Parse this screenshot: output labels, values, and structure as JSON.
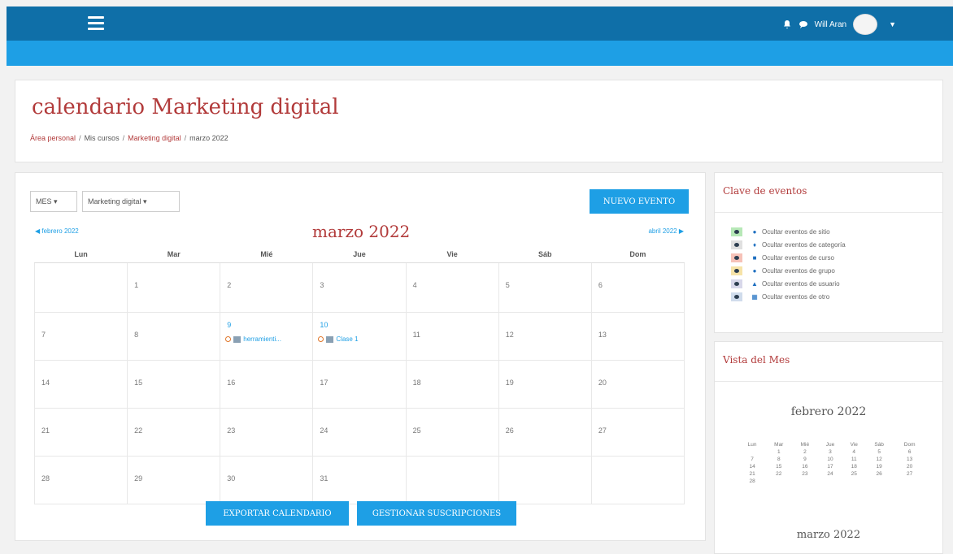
{
  "navbar": {
    "user_name": "Will Aran"
  },
  "header": {
    "title": "calendario Marketing digital",
    "breadcrumb": [
      "Área personal",
      "Mis cursos",
      "Marketing digital",
      "marzo 2022"
    ]
  },
  "calendar": {
    "view_select": "MES",
    "course_select": "Marketing digital",
    "new_event_label": "NUEVO EVENTO",
    "prev_month": "febrero 2022",
    "next_month": "abril 2022",
    "month_title": "marzo 2022",
    "weekdays": [
      "Lun",
      "Mar",
      "Mié",
      "Jue",
      "Vie",
      "Sáb",
      "Dom"
    ],
    "weeks": [
      [
        "",
        "1",
        "2",
        "3",
        "4",
        "5",
        "6"
      ],
      [
        "7",
        "8",
        "9",
        "10",
        "11",
        "12",
        "13"
      ],
      [
        "14",
        "15",
        "16",
        "17",
        "18",
        "19",
        "20"
      ],
      [
        "21",
        "22",
        "23",
        "24",
        "25",
        "26",
        "27"
      ],
      [
        "28",
        "29",
        "30",
        "31",
        "",
        "",
        ""
      ]
    ],
    "events": {
      "day9": "herramienti...",
      "day10": "Clase 1"
    },
    "export_label": "EXPORTAR CALENDARIO",
    "subscriptions_label": "GESTIONAR SUSCRIPCIONES"
  },
  "legend": {
    "title": "Clave de eventos",
    "items": [
      {
        "label": "Ocultar eventos de sitio",
        "color": "#b7e8b7",
        "icon": "globe-icon"
      },
      {
        "label": "Ocultar eventos de categoría",
        "color": "#e0e0e0",
        "icon": "cubes-icon"
      },
      {
        "label": "Ocultar eventos de curso",
        "color": "#f6c2b8",
        "icon": "graduation-icon"
      },
      {
        "label": "Ocultar eventos de grupo",
        "color": "#f6e3a8",
        "icon": "users-icon"
      },
      {
        "label": "Ocultar eventos de usuario",
        "color": "#d8d8ea",
        "icon": "user-icon"
      },
      {
        "label": "Ocultar eventos de otro",
        "color": "#d0dcec",
        "icon": "calendar-icon"
      }
    ]
  },
  "month_view": {
    "title": "Vista del Mes",
    "current_month": "febrero 2022",
    "weekdays": [
      "Lun",
      "Mar",
      "Mié",
      "Jue",
      "Vie",
      "Sáb",
      "Dom"
    ],
    "weeks": [
      [
        "",
        "1",
        "2",
        "3",
        "4",
        "5",
        "6"
      ],
      [
        "7",
        "8",
        "9",
        "10",
        "11",
        "12",
        "13"
      ],
      [
        "14",
        "15",
        "16",
        "17",
        "18",
        "19",
        "20"
      ],
      [
        "21",
        "22",
        "23",
        "24",
        "25",
        "26",
        "27"
      ],
      [
        "28",
        "",
        "",
        "",
        "",
        "",
        ""
      ]
    ],
    "next_month": "marzo 2022"
  }
}
